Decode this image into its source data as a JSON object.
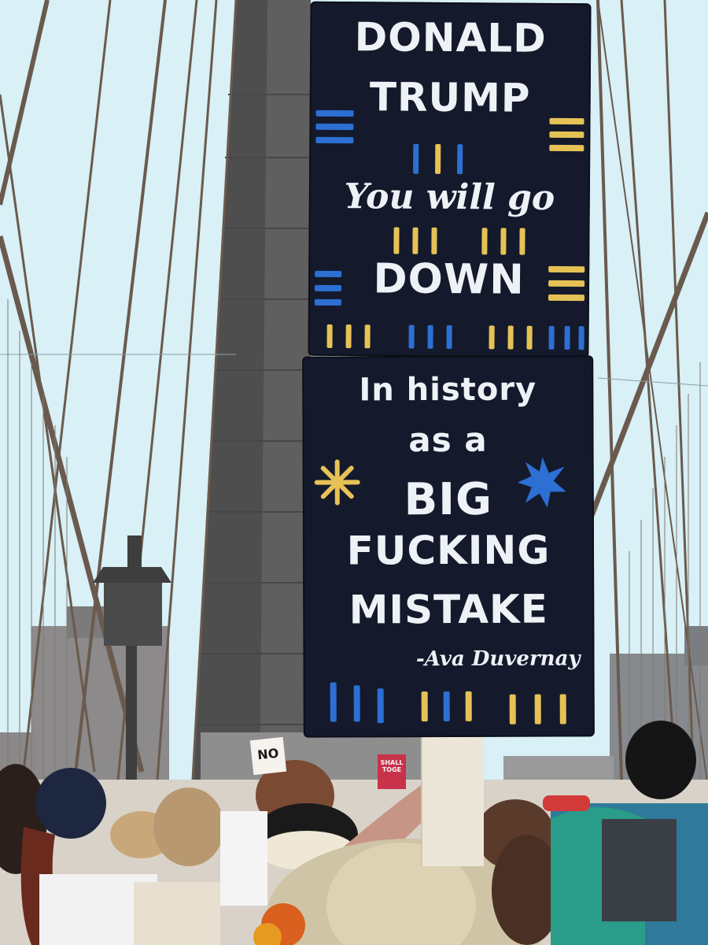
{
  "colors": {
    "sky": "#d8f0f6",
    "tower_stone": "#6b6b6b",
    "board": "#141a2b",
    "paint_white": "#eef2f6",
    "paint_blue": "#2d6fd3",
    "paint_yellow": "#e6c256"
  },
  "sign": {
    "line1": "DONALD",
    "line2": "TRUMP",
    "line3": "You will go",
    "line4": "DOWN",
    "line5": "In history",
    "line6": "as a",
    "line7": "BIG",
    "line8": "FUCKING",
    "line9": "MISTAKE",
    "attribution": "-Ava Duvernay"
  },
  "background_signs": {
    "left_sign": "NO",
    "right_sign": "SHALL TOGE"
  }
}
